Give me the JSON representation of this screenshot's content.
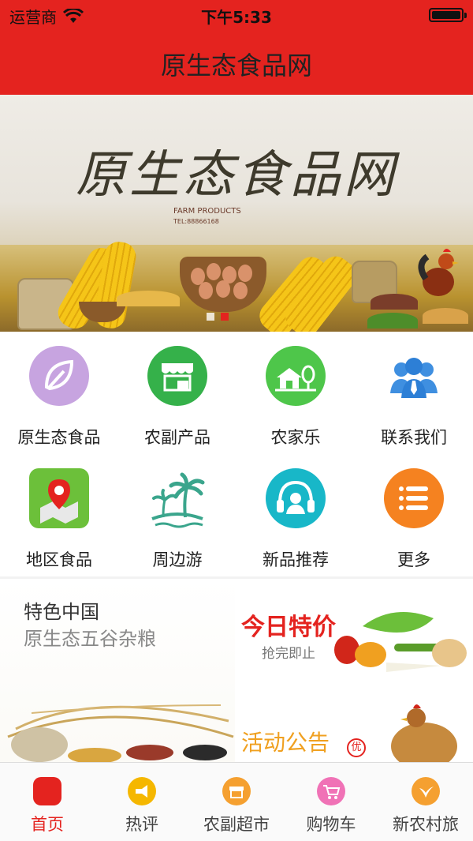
{
  "status_bar": {
    "carrier": "运营商",
    "time": "下午5:33"
  },
  "nav": {
    "title": "原生态食品网"
  },
  "banner": {
    "title": "原生态食品网",
    "subtitle": "FARM PRODUCTS",
    "phone": "TEL:88866168",
    "slide_count": 2,
    "active_slide": 2
  },
  "grid": {
    "items": [
      {
        "label": "原生态食品",
        "icon": "leaf-icon",
        "color": "#c7a4e0"
      },
      {
        "label": "农副产品",
        "icon": "shop-icon",
        "color": "#35b14a"
      },
      {
        "label": "农家乐",
        "icon": "farmhouse-icon",
        "color": "#4ec64a"
      },
      {
        "label": "联系我们",
        "icon": "contact-people-icon",
        "color": "#3f8fe0"
      },
      {
        "label": "地区食品",
        "icon": "map-pin-icon",
        "color": "#6cc03a"
      },
      {
        "label": "周边游",
        "icon": "palm-island-icon",
        "color": "#3aa58c"
      },
      {
        "label": "新品推荐",
        "icon": "headset-icon",
        "color": "#18b7c8"
      },
      {
        "label": "更多",
        "icon": "list-icon",
        "color": "#f58220"
      }
    ]
  },
  "promo": {
    "featured_title": "特色中国",
    "featured_sub": "原生态五谷杂粮",
    "today_title": "今日特价",
    "today_sub": "抢完即止",
    "activity_title": "活动公告",
    "activity_badge": "优"
  },
  "tabbar": {
    "tabs": [
      {
        "label": "首页",
        "icon": "home-icon",
        "color": "#e4231f",
        "active": true
      },
      {
        "label": "热评",
        "icon": "megaphone-icon",
        "color": "#f5b700",
        "active": false
      },
      {
        "label": "农副超市",
        "icon": "market-icon",
        "color": "#f5a030",
        "active": false
      },
      {
        "label": "购物车",
        "icon": "cart-icon",
        "color": "#f072b6",
        "active": false
      },
      {
        "label": "新农村旅",
        "icon": "bird-icon",
        "color": "#f5a030",
        "active": false
      }
    ]
  },
  "colors": {
    "brand": "#e4231f"
  }
}
